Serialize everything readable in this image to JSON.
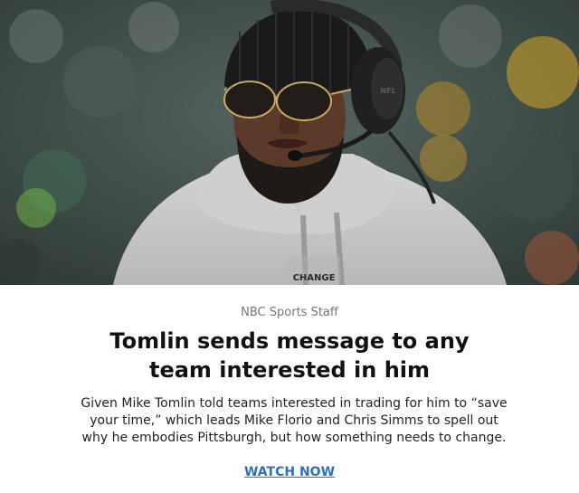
{
  "article": {
    "byline": "NBC Sports Staff",
    "headline": "Tomlin sends message to any team interested in him",
    "dek": "Given Mike Tomlin told teams interested in trading for him to “save your time,” which leads Mike Florio and Chris Simms to spell out why he embodies Pittsburgh, but how something needs to change.",
    "cta_label": "WATCH NOW"
  },
  "hero": {
    "hoodie_print": "CHANGE",
    "headset_logo": "NFL"
  },
  "colors": {
    "link": "#2e6fbe",
    "byline": "#757575",
    "headline": "#111111",
    "hoodie": "#c8c8c8",
    "beanie": "#1a1a1a"
  }
}
